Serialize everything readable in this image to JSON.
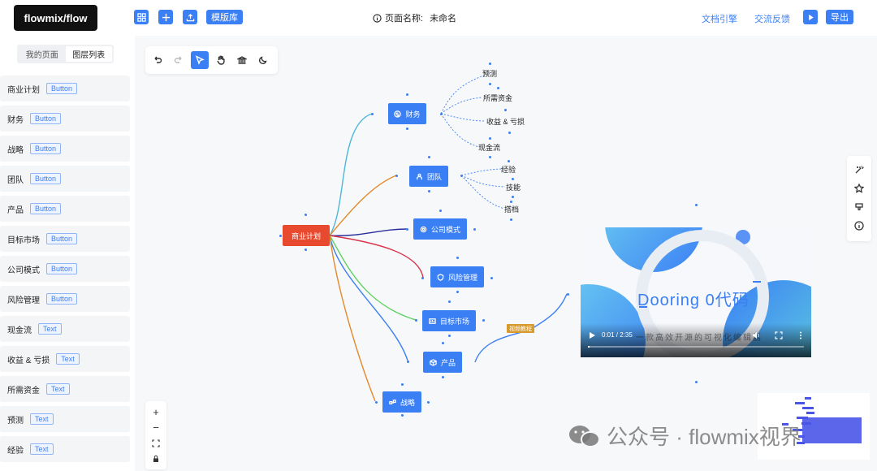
{
  "header": {
    "logo": "flowmix/flow",
    "template_label": "模版库",
    "page_name_label": "页面名称:",
    "page_name_value": "未命名",
    "docs_link": "文档引擎",
    "feedback_link": "交流反馈",
    "export_label": "导出"
  },
  "sidebar": {
    "tabs": [
      {
        "label": "我的页面",
        "active": false
      },
      {
        "label": "图层列表",
        "active": true
      }
    ],
    "items": [
      {
        "label": "商业计划",
        "tag": "Button"
      },
      {
        "label": "财务",
        "tag": "Button"
      },
      {
        "label": "战略",
        "tag": "Button"
      },
      {
        "label": "团队",
        "tag": "Button"
      },
      {
        "label": "产品",
        "tag": "Button"
      },
      {
        "label": "目标市场",
        "tag": "Button"
      },
      {
        "label": "公司模式",
        "tag": "Button"
      },
      {
        "label": "风险管理",
        "tag": "Button"
      },
      {
        "label": "现金流",
        "tag": "Text"
      },
      {
        "label": "收益 & 亏损",
        "tag": "Text"
      },
      {
        "label": "所需资金",
        "tag": "Text"
      },
      {
        "label": "预测",
        "tag": "Text"
      },
      {
        "label": "经验",
        "tag": "Text"
      }
    ]
  },
  "mindmap": {
    "root": "商业计划",
    "nodes": {
      "finance": "财务",
      "team": "团队",
      "company_model": "公司模式",
      "risk": "风险管理",
      "target_market": "目标市场",
      "product": "产品",
      "strategy": "战略"
    },
    "leaves": {
      "forecast": "预测",
      "funding": "所需资金",
      "pnl": "收益 & 亏损",
      "cashflow": "现金流",
      "experience": "经验",
      "skills": "技能",
      "partner": "搭档"
    }
  },
  "video": {
    "title": "Dooring 0代码",
    "time": "0:01 / 2:35",
    "caption": "一款高效开源的可视化编辑器",
    "progress": 0.006,
    "tag": "视频教程"
  },
  "watermark": "公众号 · flowmix视界",
  "colors": {
    "accent": "#3b7ff5",
    "root": "#e84a2f",
    "tag": "#d89a2c"
  }
}
